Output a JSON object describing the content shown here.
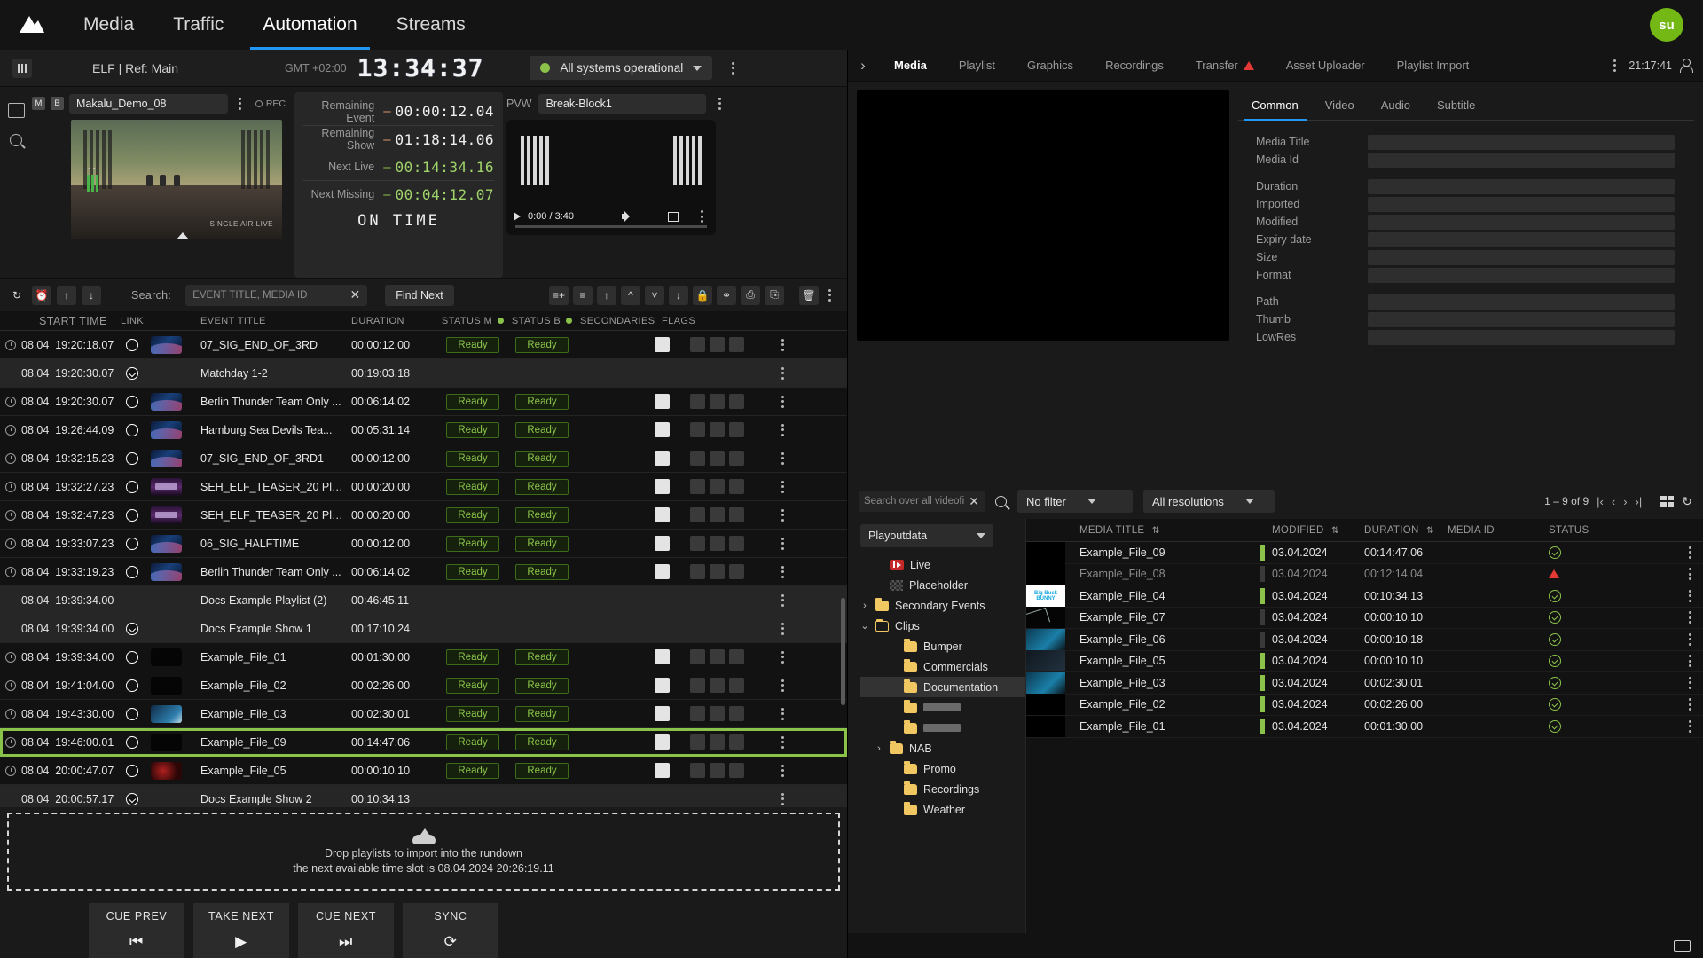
{
  "app": {
    "nav_tabs": [
      {
        "label": "Media",
        "active": false
      },
      {
        "label": "Traffic",
        "active": false
      },
      {
        "label": "Automation",
        "active": true
      },
      {
        "label": "Streams",
        "active": false
      }
    ],
    "avatar_initials": "su"
  },
  "channel_bar": {
    "title": "ELF | Ref: Main",
    "gmt_label": "GMT +02:00",
    "clock": "13:34:37",
    "system_status": "All systems operational",
    "status_color": "#8bc34a"
  },
  "onair": {
    "pgm_badge_m": "M",
    "pgm_badge_b": "B",
    "pgm_name": "Makalu_Demo_08",
    "rec_label": "REC",
    "pvw_label": "PVW",
    "pvw_name": "Break-Block1",
    "player_time": "0:00 / 3:40",
    "timers": [
      {
        "label": "Remaining Event",
        "sign": "–",
        "value": "00:00:12.04",
        "green": false
      },
      {
        "label": "Remaining Show",
        "sign": "–",
        "value": "01:18:14.06",
        "green": false
      },
      {
        "label": "Next Live",
        "sign": "–",
        "value": "00:14:34.16",
        "green": true
      },
      {
        "label": "Next Missing",
        "sign": "–",
        "value": "00:04:12.07",
        "green": true
      }
    ],
    "on_time": "ON TIME"
  },
  "rundown_toolbar": {
    "search_label": "Search:",
    "search_value": "",
    "search_placeholder": "EVENT TITLE, MEDIA ID",
    "find_next": "Find Next"
  },
  "rundown": {
    "columns": [
      "START TIME",
      "LINK",
      "EVENT TITLE",
      "DURATION",
      "STATUS M",
      "STATUS B",
      "SECONDARIES",
      "FLAGS"
    ],
    "status_m_label": "STATUS M",
    "status_b_label": "STATUS B",
    "rows": [
      {
        "date": "08.04",
        "time": "19:20:18.07",
        "title": "07_SIG_END_OF_3RD",
        "duration": "00:00:12.00",
        "status_m": "Ready",
        "status_b": "Ready",
        "type": "event",
        "thumb": "space"
      },
      {
        "date": "08.04",
        "time": "19:20:30.07",
        "title": "Matchday 1-2",
        "duration": "00:19:03.18",
        "status_m": "",
        "status_b": "",
        "type": "group",
        "thumb": ""
      },
      {
        "date": "08.04",
        "time": "19:20:30.07",
        "title": "Berlin Thunder Team Only ...",
        "duration": "00:06:14.02",
        "status_m": "Ready",
        "status_b": "Ready",
        "type": "event",
        "thumb": "space"
      },
      {
        "date": "08.04",
        "time": "19:26:44.09",
        "title": "Hamburg Sea Devils Tea...",
        "duration": "00:05:31.14",
        "status_m": "Ready",
        "status_b": "Ready",
        "type": "event",
        "thumb": "space"
      },
      {
        "date": "08.04",
        "time": "19:32:15.23",
        "title": "07_SIG_END_OF_3RD1",
        "duration": "00:00:12.00",
        "status_m": "Ready",
        "status_b": "Ready",
        "type": "event",
        "thumb": "space"
      },
      {
        "date": "08.04",
        "time": "19:32:27.23",
        "title": "SEH_ELF_TEASER_20 Pla...",
        "duration": "00:00:20.00",
        "status_m": "Ready",
        "status_b": "Ready",
        "type": "event",
        "thumb": "teaser"
      },
      {
        "date": "08.04",
        "time": "19:32:47.23",
        "title": "SEH_ELF_TEASER_20 Pla...",
        "duration": "00:00:20.00",
        "status_m": "Ready",
        "status_b": "Ready",
        "type": "event",
        "thumb": "teaser"
      },
      {
        "date": "08.04",
        "time": "19:33:07.23",
        "title": "06_SIG_HALFTIME",
        "duration": "00:00:12.00",
        "status_m": "Ready",
        "status_b": "Ready",
        "type": "event",
        "thumb": "space"
      },
      {
        "date": "08.04",
        "time": "19:33:19.23",
        "title": "Berlin Thunder Team Only ...",
        "duration": "00:06:14.02",
        "status_m": "Ready",
        "status_b": "Ready",
        "type": "event",
        "thumb": "space"
      },
      {
        "date": "08.04",
        "time": "19:39:34.00",
        "title": "Docs Example Playlist (2)",
        "duration": "00:46:45.11",
        "status_m": "",
        "status_b": "",
        "type": "playlist",
        "thumb": ""
      },
      {
        "date": "08.04",
        "time": "19:39:34.00",
        "title": "Docs Example Show 1",
        "duration": "00:17:10.24",
        "status_m": "",
        "status_b": "",
        "type": "group",
        "thumb": ""
      },
      {
        "date": "08.04",
        "time": "19:39:34.00",
        "title": "Example_File_01",
        "duration": "00:01:30.00",
        "status_m": "Ready",
        "status_b": "Ready",
        "type": "event",
        "thumb": "blk"
      },
      {
        "date": "08.04",
        "time": "19:41:04.00",
        "title": "Example_File_02",
        "duration": "00:02:26.00",
        "status_m": "Ready",
        "status_b": "Ready",
        "type": "event",
        "thumb": "blk"
      },
      {
        "date": "08.04",
        "time": "19:43:30.00",
        "title": "Example_File_03",
        "duration": "00:02:30.01",
        "status_m": "Ready",
        "status_b": "Ready",
        "type": "event",
        "thumb": "blue"
      },
      {
        "date": "08.04",
        "time": "19:46:00.01",
        "title": "Example_File_09",
        "duration": "00:14:47.06",
        "status_m": "Ready",
        "status_b": "Ready",
        "type": "event",
        "thumb": "blk",
        "selected": true
      },
      {
        "date": "08.04",
        "time": "20:00:47.07",
        "title": "Example_File_05",
        "duration": "00:00:10.10",
        "status_m": "Ready",
        "status_b": "Ready",
        "type": "event",
        "thumb": "red"
      },
      {
        "date": "08.04",
        "time": "20:00:57.17",
        "title": "Docs Example Show 2",
        "duration": "00:10:34.13",
        "status_m": "",
        "status_b": "",
        "type": "group",
        "thumb": ""
      }
    ],
    "selected_color": "#8bc34a"
  },
  "dropzone": {
    "line1": "Drop playlists to import into the rundown",
    "line2": "the next available time slot is 08.04.2024 20:26:19.11"
  },
  "transport": [
    {
      "label": "CUE PREV",
      "glyph": "⏮"
    },
    {
      "label": "TAKE NEXT",
      "glyph": "▶"
    },
    {
      "label": "CUE NEXT",
      "glyph": "⏭"
    },
    {
      "label": "SYNC",
      "glyph": "⟳"
    }
  ],
  "right_tabs": {
    "items": [
      {
        "label": "Media",
        "active": true,
        "warn": false
      },
      {
        "label": "Playlist",
        "active": false,
        "warn": false
      },
      {
        "label": "Graphics",
        "active": false,
        "warn": false
      },
      {
        "label": "Recordings",
        "active": false,
        "warn": false
      },
      {
        "label": "Transfer",
        "active": false,
        "warn": true
      },
      {
        "label": "Asset Uploader",
        "active": false,
        "warn": false
      },
      {
        "label": "Playlist Import",
        "active": false,
        "warn": false
      }
    ],
    "clock": "21:17:41"
  },
  "meta": {
    "tabs": [
      {
        "label": "Common",
        "active": true
      },
      {
        "label": "Video",
        "active": false
      },
      {
        "label": "Audio",
        "active": false
      },
      {
        "label": "Subtitle",
        "active": false
      }
    ],
    "fields": [
      {
        "label": "Media Title",
        "value": ""
      },
      {
        "label": "Media Id",
        "value": ""
      },
      {
        "label": "Duration",
        "value": ""
      },
      {
        "label": "Imported",
        "value": ""
      },
      {
        "label": "Modified",
        "value": ""
      },
      {
        "label": "Expiry date",
        "value": ""
      },
      {
        "label": "Size",
        "value": ""
      },
      {
        "label": "Format",
        "value": ""
      },
      {
        "label": "Path",
        "value": ""
      },
      {
        "label": "Thumb",
        "value": ""
      },
      {
        "label": "LowRes",
        "value": ""
      }
    ]
  },
  "media_browser": {
    "search_value": "",
    "search_placeholder": "Search over all videofi",
    "filter": "No filter",
    "resolution": "All resolutions",
    "count": "1 – 9 of 9",
    "tree_root": "Playoutdata",
    "tree": [
      {
        "label": "Live",
        "icon": "live-icon",
        "indent": 1,
        "arrow": "",
        "highlight": false
      },
      {
        "label": "Placeholder",
        "icon": "placeholder-icon",
        "indent": 1,
        "arrow": "",
        "highlight": false
      },
      {
        "label": "Secondary Events",
        "icon": "folder-icon",
        "indent": 0,
        "arrow": "›",
        "highlight": false
      },
      {
        "label": "Clips",
        "icon": "folder-open-icon",
        "indent": 0,
        "arrow": "⌄",
        "highlight": false
      },
      {
        "label": "Bumper",
        "icon": "folder-icon",
        "indent": 2,
        "arrow": "",
        "highlight": false
      },
      {
        "label": "Commercials",
        "icon": "folder-icon",
        "indent": 2,
        "arrow": "",
        "highlight": false
      },
      {
        "label": "Documentation",
        "icon": "folder-icon",
        "indent": 2,
        "arrow": "",
        "highlight": true
      },
      {
        "label": "",
        "icon": "folder-icon",
        "indent": 2,
        "arrow": "",
        "highlight": false,
        "blurred": true
      },
      {
        "label": "",
        "icon": "folder-icon",
        "indent": 2,
        "arrow": "",
        "highlight": false,
        "blurred": true
      },
      {
        "label": "NAB",
        "icon": "folder-icon",
        "indent": 1,
        "arrow": "›",
        "highlight": false
      },
      {
        "label": "Promo",
        "icon": "folder-icon",
        "indent": 2,
        "arrow": "",
        "highlight": false
      },
      {
        "label": "Recordings",
        "icon": "folder-icon",
        "indent": 2,
        "arrow": "",
        "highlight": false
      },
      {
        "label": "Weather",
        "icon": "folder-icon",
        "indent": 2,
        "arrow": "",
        "highlight": false
      }
    ],
    "columns": [
      "MEDIA TITLE",
      "MODIFIED",
      "DURATION",
      "MEDIA ID",
      "STATUS"
    ],
    "rows": [
      {
        "title": "Example_File_09",
        "modified": "03.04.2024",
        "duration": "00:14:47.06",
        "media_id": "",
        "status": "ok",
        "thumb": "blk",
        "dim": false,
        "bar": true
      },
      {
        "title": "Example_File_08",
        "modified": "03.04.2024",
        "duration": "00:12:14.04",
        "media_id": "",
        "status": "warn",
        "thumb": "blk",
        "dim": true,
        "bar": false
      },
      {
        "title": "Example_File_04",
        "modified": "03.04.2024",
        "duration": "00:10:34.13",
        "media_id": "",
        "status": "ok",
        "thumb": "bunny",
        "dim": false,
        "bar": true
      },
      {
        "title": "Example_File_07",
        "modified": "03.04.2024",
        "duration": "00:00:10.10",
        "media_id": "",
        "status": "ok",
        "thumb": "wire",
        "dim": false,
        "bar": false
      },
      {
        "title": "Example_File_06",
        "modified": "03.04.2024",
        "duration": "00:00:10.18",
        "media_id": "",
        "status": "ok",
        "thumb": "teal",
        "dim": false,
        "bar": false
      },
      {
        "title": "Example_File_05",
        "modified": "03.04.2024",
        "duration": "00:00:10.10",
        "media_id": "",
        "status": "ok",
        "thumb": "drk",
        "dim": false,
        "bar": true
      },
      {
        "title": "Example_File_03",
        "modified": "03.04.2024",
        "duration": "00:02:30.01",
        "media_id": "",
        "status": "ok",
        "thumb": "teal",
        "dim": false,
        "bar": true
      },
      {
        "title": "Example_File_02",
        "modified": "03.04.2024",
        "duration": "00:02:26.00",
        "media_id": "",
        "status": "ok",
        "thumb": "blk",
        "dim": false,
        "bar": true
      },
      {
        "title": "Example_File_01",
        "modified": "03.04.2024",
        "duration": "00:01:30.00",
        "media_id": "",
        "status": "ok",
        "thumb": "blk",
        "dim": false,
        "bar": true
      }
    ],
    "bunny_thumb_text": "Big Buck BUNNY"
  }
}
